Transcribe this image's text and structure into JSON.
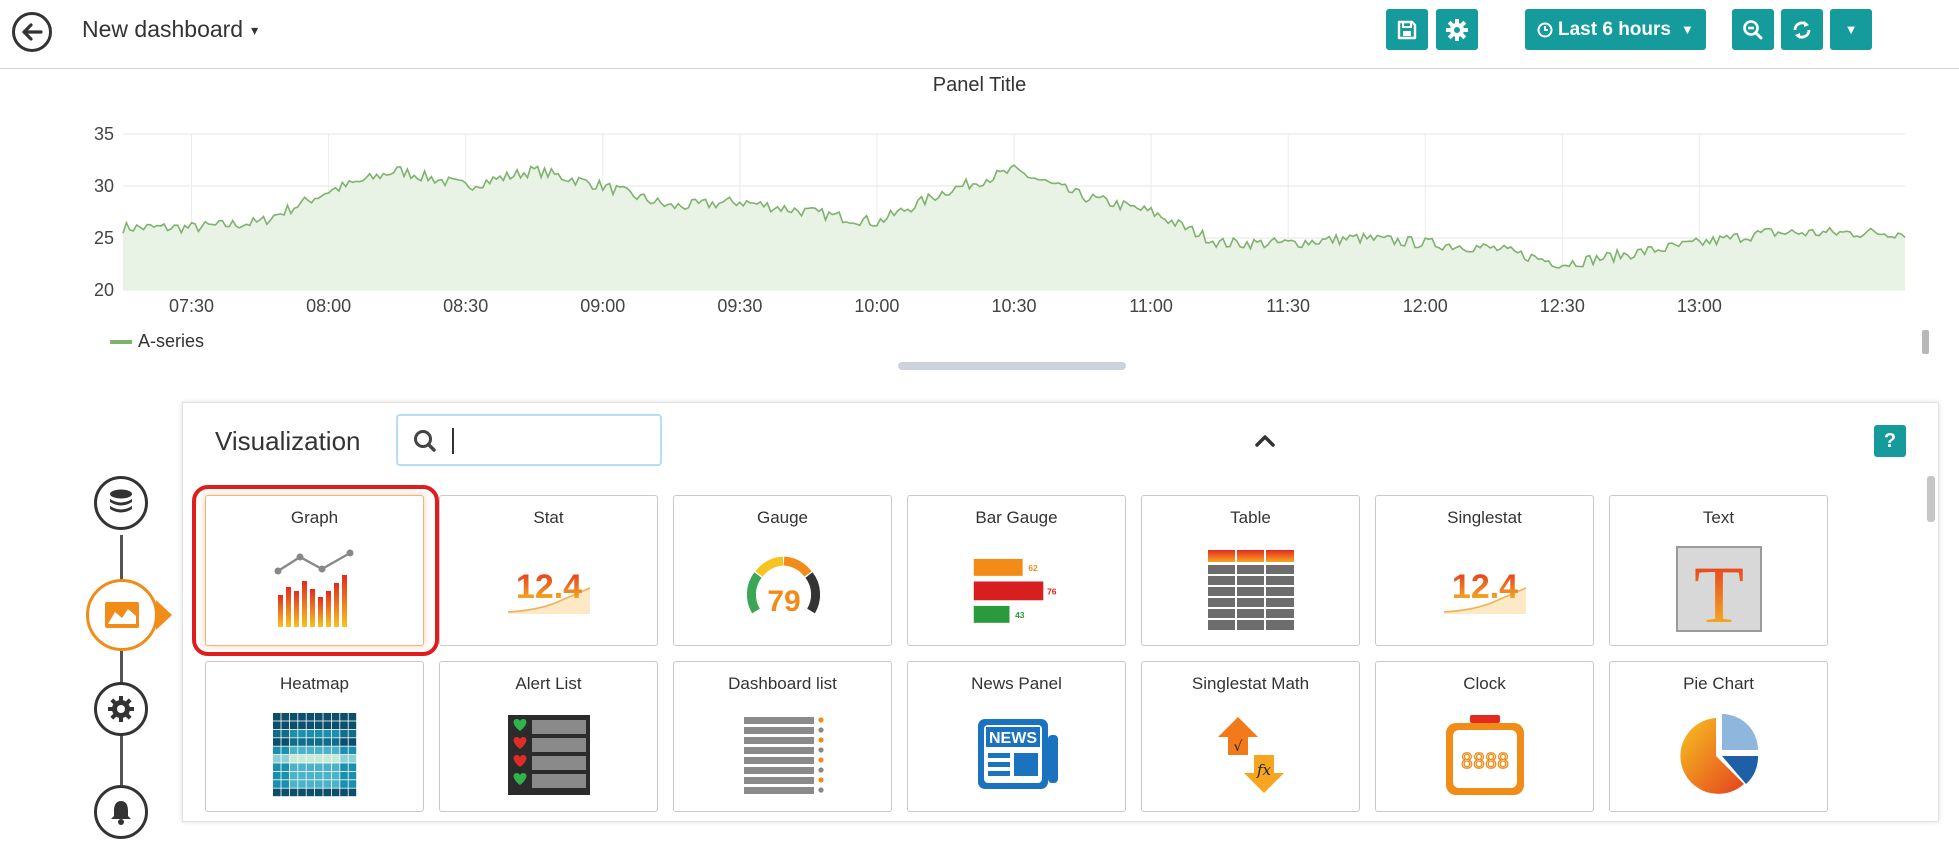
{
  "header": {
    "dashboard_title": "New dashboard",
    "time_range_label": "Last 6 hours"
  },
  "panel": {
    "title": "Panel Title",
    "legend_label": "A-series"
  },
  "chart_data": {
    "type": "area",
    "title": "Panel Title",
    "ylim": [
      20,
      35
    ],
    "yticks": [
      20,
      25,
      30,
      35
    ],
    "x_tick_labels": [
      "07:30",
      "08:00",
      "08:30",
      "09:00",
      "09:30",
      "10:00",
      "10:30",
      "11:00",
      "11:30",
      "12:00",
      "12:30",
      "13:00"
    ],
    "grid": true,
    "legend": "bottom-left",
    "series": [
      {
        "name": "A-series",
        "color": "#7eb26d",
        "x": [
          "07:30",
          "07:45",
          "08:00",
          "08:15",
          "08:30",
          "08:45",
          "09:00",
          "09:15",
          "09:30",
          "09:45",
          "10:00",
          "10:15",
          "10:30",
          "10:45",
          "11:00",
          "11:15",
          "11:30",
          "11:45",
          "12:00",
          "12:15",
          "12:30",
          "12:45",
          "13:00",
          "13:15"
        ],
        "values": [
          26,
          26.5,
          29.5,
          31.5,
          30,
          31.5,
          30,
          28,
          28.5,
          27.5,
          26.5,
          29.5,
          31.5,
          29,
          27.5,
          24.5,
          24.5,
          25,
          24.5,
          24,
          22.5,
          23.5,
          24.5,
          25.5
        ]
      }
    ]
  },
  "visualization": {
    "heading": "Visualization",
    "search_placeholder": "",
    "help_label": "?",
    "cards": [
      {
        "label": "Graph"
      },
      {
        "label": "Stat",
        "value": "12.4"
      },
      {
        "label": "Gauge",
        "value": "79"
      },
      {
        "label": "Bar Gauge",
        "values": [
          "62",
          "76",
          "43"
        ]
      },
      {
        "label": "Table"
      },
      {
        "label": "Singlestat",
        "value": "12.4"
      },
      {
        "label": "Text",
        "glyph": "T"
      },
      {
        "label": "Heatmap"
      },
      {
        "label": "Alert List"
      },
      {
        "label": "Dashboard list"
      },
      {
        "label": "News Panel",
        "badge": "NEWS"
      },
      {
        "label": "Singlestat Math"
      },
      {
        "label": "Clock",
        "display": "8888"
      },
      {
        "label": "Pie Chart"
      }
    ]
  },
  "colors": {
    "accent": "#169b9c",
    "series": "#7eb26d",
    "active_step": "#f28c18",
    "selection": "#e01d1d"
  }
}
